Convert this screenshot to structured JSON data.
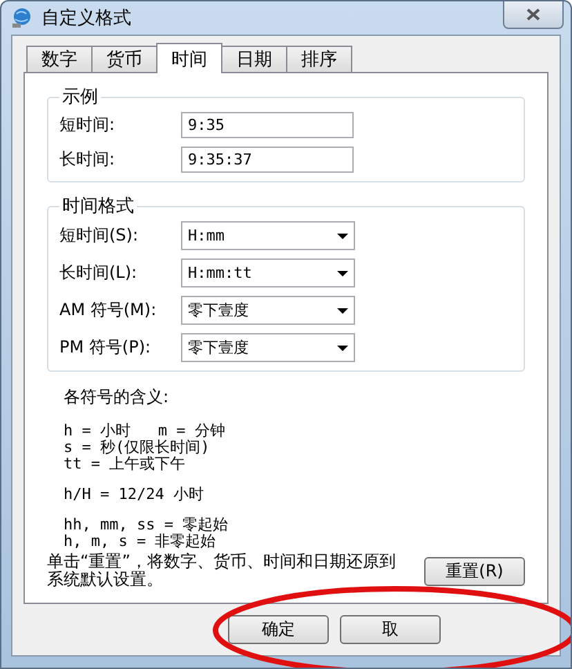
{
  "window": {
    "title": "自定义格式"
  },
  "tabs": [
    {
      "label": "数字",
      "selected": false
    },
    {
      "label": "货币",
      "selected": false
    },
    {
      "label": "时间",
      "selected": true
    },
    {
      "label": "日期",
      "selected": false
    },
    {
      "label": "排序",
      "selected": false
    }
  ],
  "example": {
    "title": "示例",
    "fields": [
      {
        "label": "短时间:",
        "value": "9:35"
      },
      {
        "label": "长时间:",
        "value": "9:35:37"
      }
    ]
  },
  "formats": {
    "title": "时间格式",
    "fields": [
      {
        "label": "短时间(S):",
        "value": "H:mm"
      },
      {
        "label": "长时间(L):",
        "value": "H:mm:tt"
      },
      {
        "label": "AM 符号(M):",
        "value": "零下壹度"
      },
      {
        "label": "PM 符号(P):",
        "value": "零下壹度"
      }
    ]
  },
  "legend": {
    "title": "各符号的含义:",
    "blocks": [
      [
        "h = 小时   m = 分钟",
        "s = 秒(仅限长时间)",
        "tt = 上午或下午"
      ],
      [
        "h/H = 12/24 小时"
      ],
      [
        "hh, mm, ss = 零起始",
        "h, m, s = 非零起始"
      ]
    ]
  },
  "reset": {
    "note": "单击“重置”，将数字、货币、时间和日期还原到系统默认设置。",
    "button": "重置(R)"
  },
  "buttons": [
    "确定",
    "取"
  ]
}
